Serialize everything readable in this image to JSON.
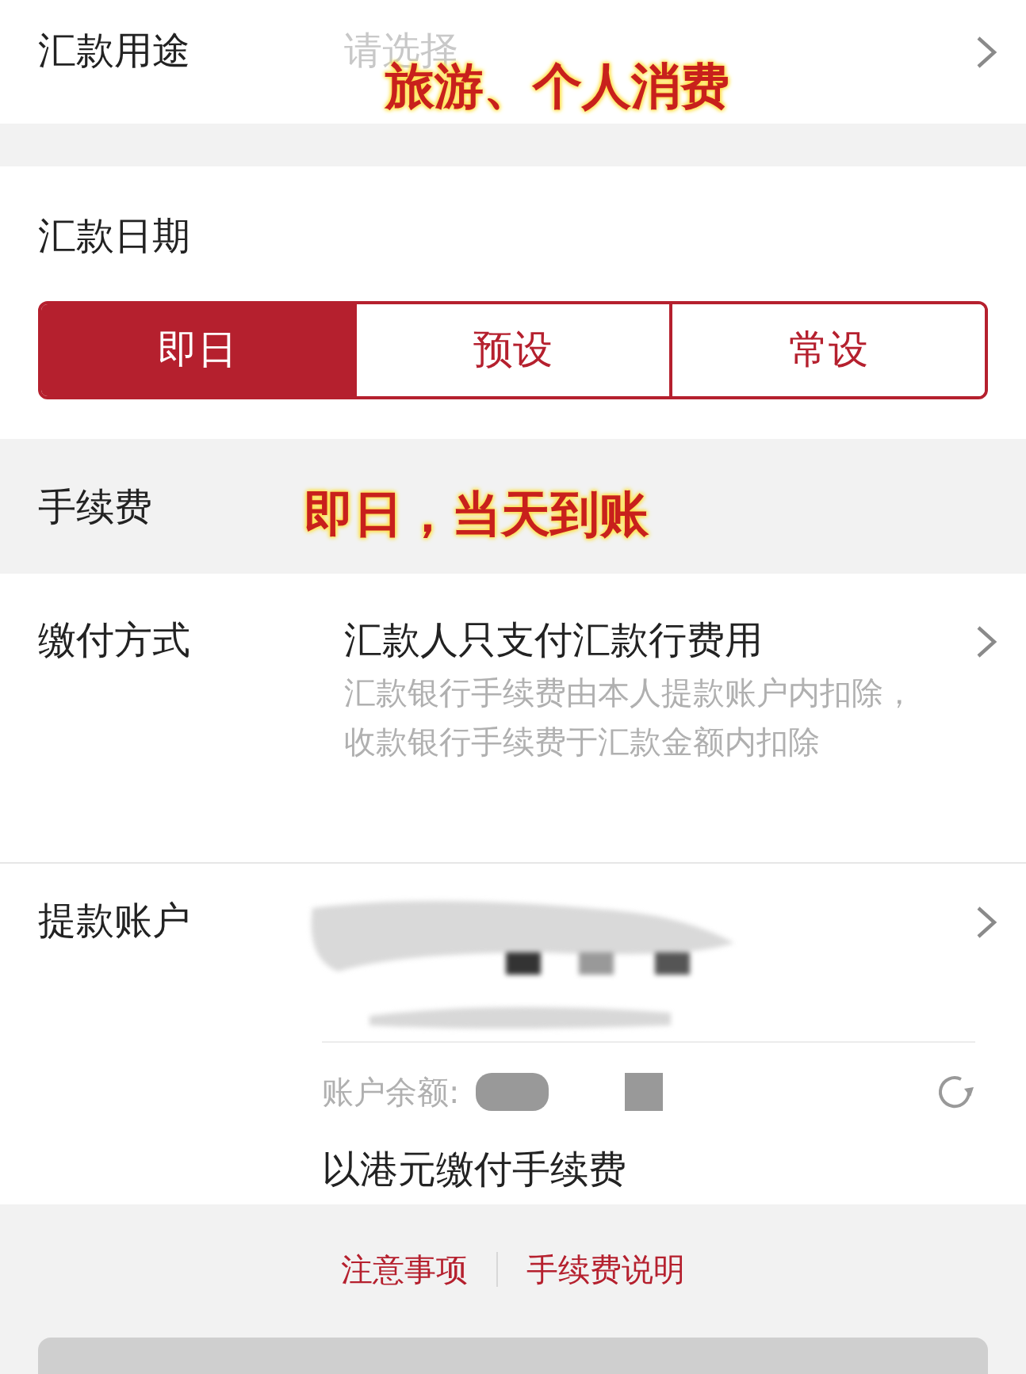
{
  "purpose": {
    "label": "汇款用途",
    "placeholder": "请选择"
  },
  "date": {
    "label": "汇款日期",
    "options": [
      {
        "label": "即日",
        "selected": true
      },
      {
        "label": "预设",
        "selected": false
      },
      {
        "label": "常设",
        "selected": false
      }
    ]
  },
  "fee_section": {
    "title": "手续费"
  },
  "payment_method": {
    "label": "缴付方式",
    "value": "汇款人只支付汇款行费用",
    "note": "汇款银行手续费由本人提款账户内扣除，收款银行手续费于汇款金额内扣除"
  },
  "account": {
    "label": "提款账户",
    "balance_label": "账户余额:",
    "fee_currency": "以港元缴付手续费"
  },
  "links": [
    "注意事项",
    "手续费说明"
  ],
  "annotations": [
    "旅游、个人消费",
    "即日，当天到账"
  ]
}
